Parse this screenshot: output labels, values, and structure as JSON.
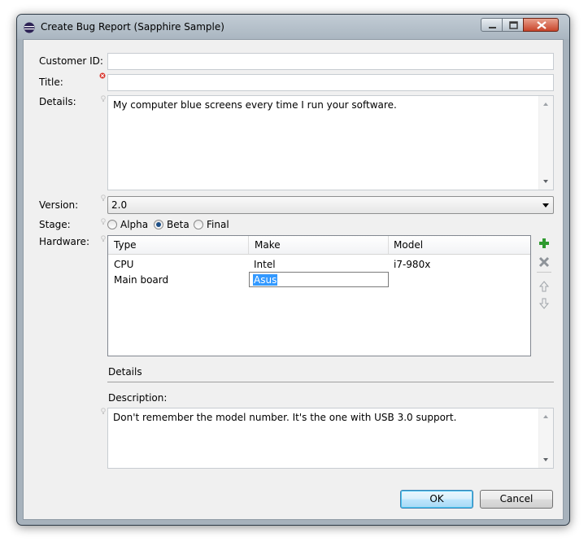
{
  "window": {
    "title": "Create Bug Report (Sapphire Sample)"
  },
  "form": {
    "customer_id": {
      "label": "Customer ID:",
      "value": ""
    },
    "title": {
      "label": "Title:",
      "value": ""
    },
    "details": {
      "label": "Details:",
      "value": "My computer blue screens every time I run your software."
    },
    "version": {
      "label": "Version:",
      "value": "2.0"
    },
    "stage": {
      "label": "Stage:",
      "options": [
        "Alpha",
        "Beta",
        "Final"
      ],
      "selected": "Beta"
    },
    "hardware": {
      "label": "Hardware:",
      "columns": [
        "Type",
        "Make",
        "Model"
      ],
      "rows": [
        {
          "type": "CPU",
          "make": "Intel",
          "model": "i7-980x"
        },
        {
          "type": "Main board",
          "make": "Asus",
          "model": ""
        }
      ],
      "editing_value": "Asus"
    },
    "details_section": {
      "heading": "Details",
      "description_label": "Description:",
      "description_value": "Don't remember the model number. It's the one with USB 3.0 support."
    }
  },
  "buttons": {
    "ok": "OK",
    "cancel": "Cancel"
  },
  "icons": {
    "app": "eclipse-icon",
    "title_error": "error-marker-icon",
    "assist": "content-assist-bulb-icon",
    "add": "add-icon",
    "delete": "delete-icon",
    "move_up": "arrow-up-icon",
    "move_down": "arrow-down-icon"
  },
  "colors": {
    "selection": "#3399ff",
    "add": "#2f9a2f",
    "error": "#d9342b"
  }
}
